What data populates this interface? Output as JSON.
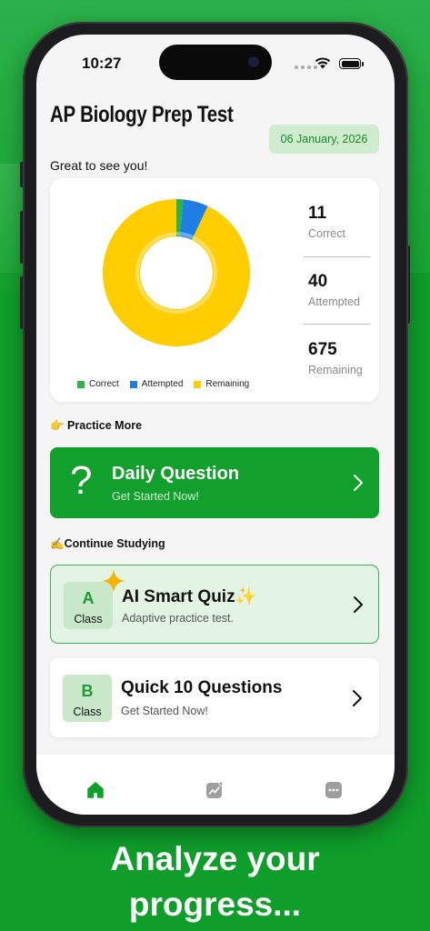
{
  "status_bar": {
    "time": "10:27"
  },
  "header": {
    "app_title": "AP Biology Prep Test",
    "greeting": "Great to see you!",
    "date": "06 January, 2026"
  },
  "stats": {
    "correct": {
      "value": "11",
      "label": "Correct"
    },
    "attempted": {
      "value": "40",
      "label": "Attempted"
    },
    "remaining": {
      "value": "675",
      "label": "Remaining"
    }
  },
  "chart_data": {
    "type": "pie",
    "categories": [
      "Correct",
      "Attempted",
      "Remaining"
    ],
    "values": [
      11,
      40,
      675
    ],
    "colors": [
      "#2cb34a",
      "#1e7ee6",
      "#ffcd00"
    ]
  },
  "legend": {
    "correct": "Correct",
    "attempted": "Attempted",
    "remaining": "Remaining"
  },
  "practice": {
    "heading": "👉 Practice More",
    "daily": {
      "icon": "?",
      "title": "Daily Question",
      "subtitle": "Get Started Now!"
    }
  },
  "continue": {
    "heading": "✍️Continue Studying",
    "ai_quiz": {
      "badge_letter": "A",
      "badge_label": "Class",
      "title": "AI Smart Quiz✨",
      "subtitle": "Adaptive practice test."
    },
    "quick10": {
      "badge_letter": "B",
      "badge_label": "Class",
      "title": "Quick 10 Questions",
      "subtitle": "Get Started Now!"
    }
  },
  "tabs": [
    "home-icon",
    "progress-chart-icon",
    "more-icon"
  ],
  "tagline": {
    "line1": "Analyze your",
    "line2": "progress..."
  },
  "colors": {
    "brand_green": "#12a02c",
    "accent_yellow": "#ffcd00",
    "accent_blue": "#1e7ee6"
  }
}
